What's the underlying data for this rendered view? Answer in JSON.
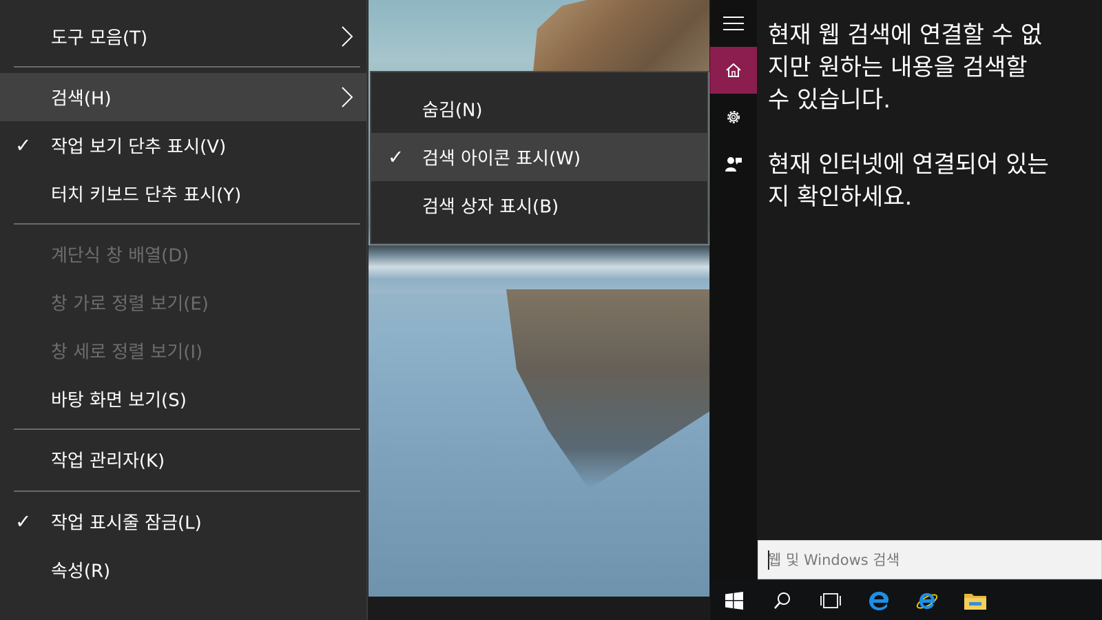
{
  "context_menu": {
    "items": [
      {
        "label": "도구 모음(T)",
        "checked": false,
        "disabled": false,
        "submenu": true
      },
      {
        "label": "검색(H)",
        "checked": false,
        "disabled": false,
        "submenu": true,
        "highlighted": true
      },
      {
        "label": "작업 보기 단추 표시(V)",
        "checked": true,
        "disabled": false
      },
      {
        "label": "터치 키보드 단추 표시(Y)",
        "checked": false,
        "disabled": false
      },
      {
        "label": "계단식 창 배열(D)",
        "checked": false,
        "disabled": true
      },
      {
        "label": "창 가로 정렬 보기(E)",
        "checked": false,
        "disabled": true
      },
      {
        "label": "창 세로 정렬 보기(I)",
        "checked": false,
        "disabled": true
      },
      {
        "label": "바탕 화면 보기(S)",
        "checked": false,
        "disabled": false
      },
      {
        "label": "작업 관리자(K)",
        "checked": false,
        "disabled": false
      },
      {
        "label": "작업 표시줄 잠금(L)",
        "checked": true,
        "disabled": false
      },
      {
        "label": "속성(R)",
        "checked": false,
        "disabled": false
      }
    ],
    "check_glyph": "✓"
  },
  "search_submenu": {
    "items": [
      {
        "label": "숨김(N)",
        "checked": false
      },
      {
        "label": "검색 아이콘 표시(W)",
        "checked": true,
        "highlighted": true
      },
      {
        "label": "검색 상자 표시(B)",
        "checked": false
      }
    ]
  },
  "cortana": {
    "message": "현재 웹 검색에 연결할 수 없\n지만 원하는 내용을 검색할\n수 있습니다.\n\n현재 인터넷에 연결되어 있는\n지 확인하세요.",
    "search_placeholder": "웹 및 Windows 검색",
    "rail_icons": [
      "hamburger-icon",
      "home-icon",
      "gear-icon",
      "feedback-icon"
    ],
    "accent_color": "#8b1e4f"
  },
  "taskbar": {
    "icons": [
      "windows-start-icon",
      "search-icon",
      "task-view-icon",
      "edge-icon",
      "internet-explorer-icon",
      "file-explorer-icon"
    ]
  }
}
